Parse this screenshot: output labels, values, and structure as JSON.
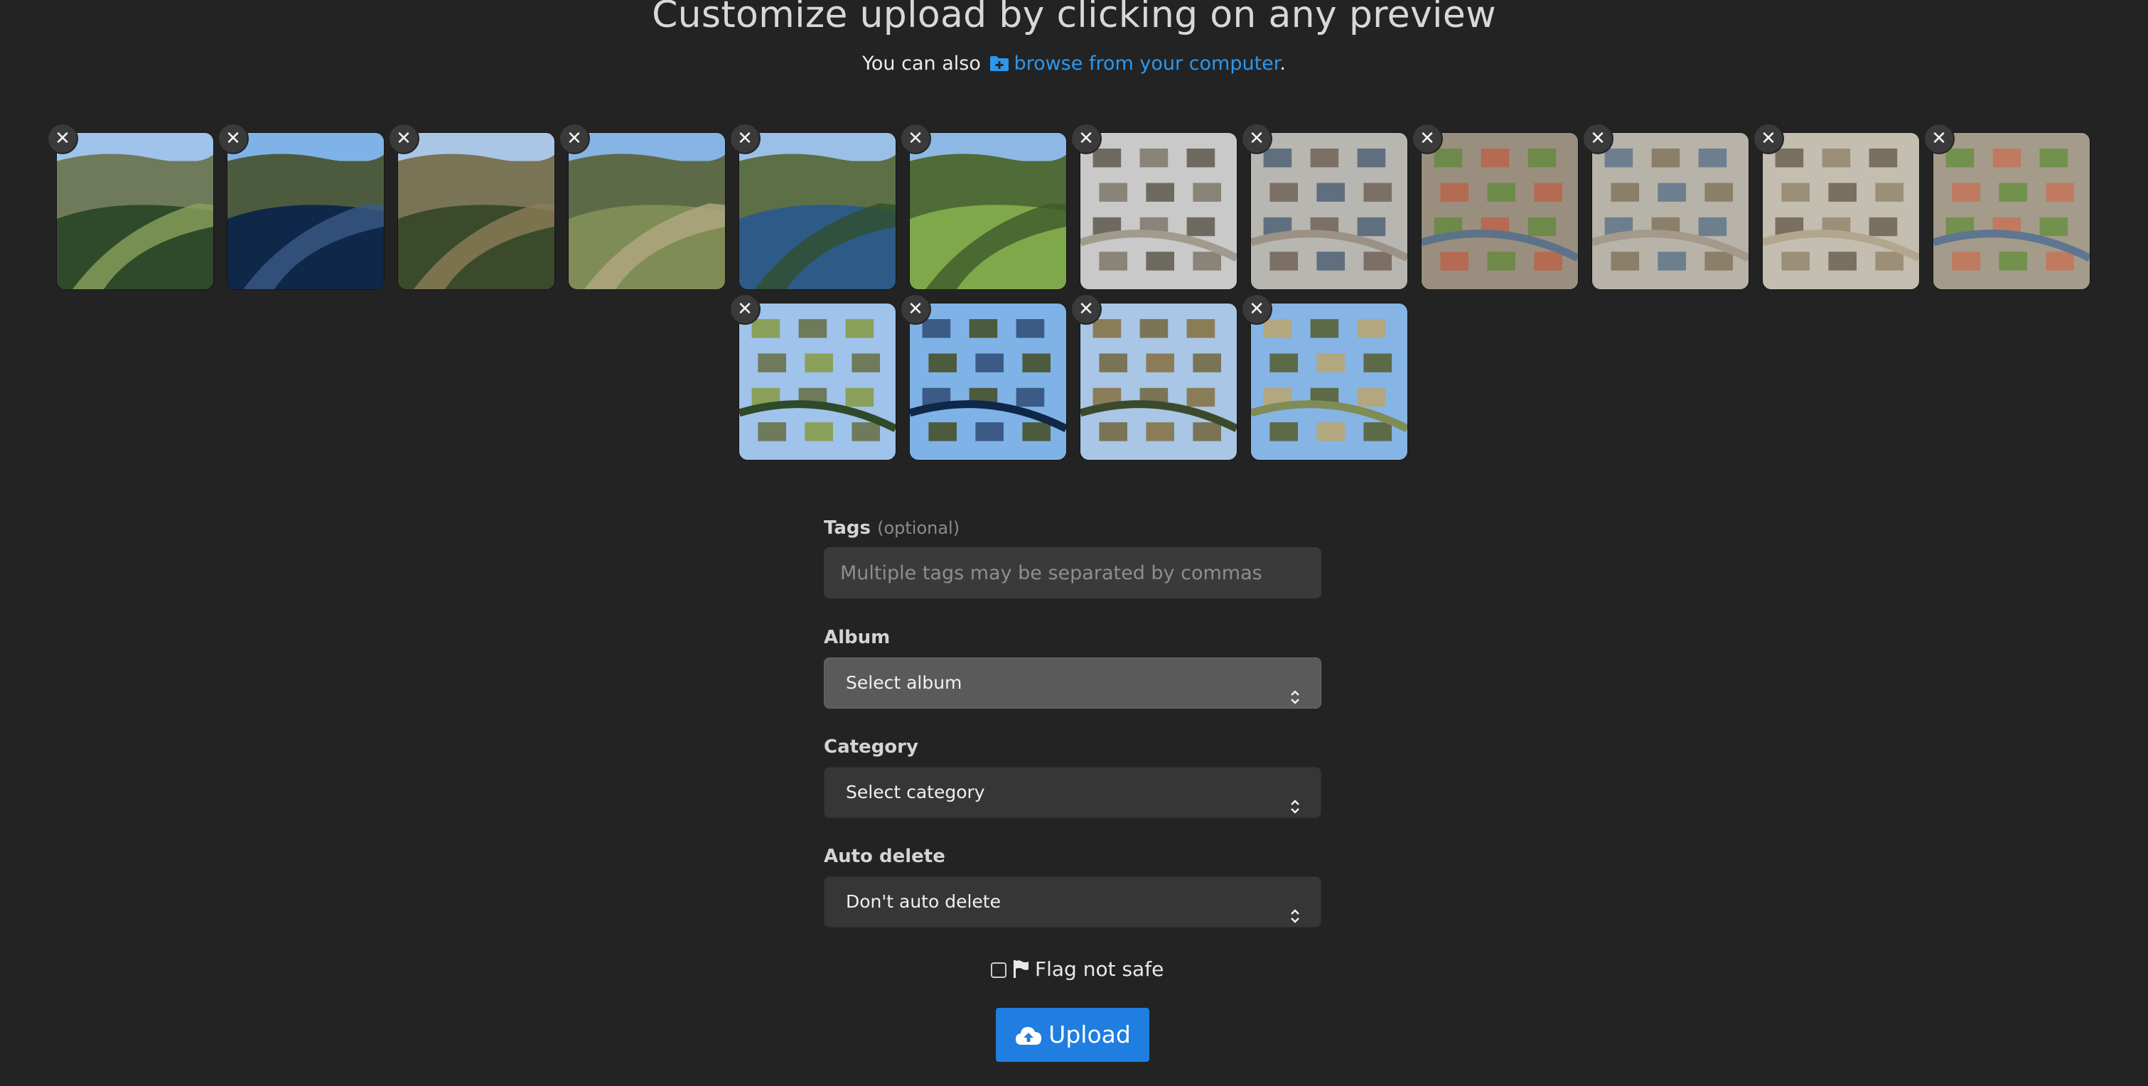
{
  "header": {
    "title": "Customize upload by clicking on any preview",
    "browse_prefix": "You can also",
    "browse_link": "browse from your computer",
    "browse_suffix": "."
  },
  "icons": {
    "remove": "close-icon",
    "browse": "folder-plus-icon",
    "nsfw": "flag-icon",
    "upload": "cloud-upload-icon",
    "select": "chevron-up-down-icon"
  },
  "previews": [
    {
      "name": "green-valley-hillside",
      "remove_glyph": "✕"
    },
    {
      "name": "blue-reservoir",
      "remove_glyph": "✕"
    },
    {
      "name": "moorland-trees",
      "remove_glyph": "✕"
    },
    {
      "name": "valley-track",
      "remove_glyph": "✕"
    },
    {
      "name": "reservoir-forest",
      "remove_glyph": "✕"
    },
    {
      "name": "green-slope",
      "remove_glyph": "✕"
    },
    {
      "name": "hazy-construction-site",
      "remove_glyph": "✕"
    },
    {
      "name": "housing-estate-aerial",
      "remove_glyph": "✕"
    },
    {
      "name": "houses-rows",
      "remove_glyph": "✕"
    },
    {
      "name": "estate-building-plots",
      "remove_glyph": "✕"
    },
    {
      "name": "cleared-site-roads",
      "remove_glyph": "✕"
    },
    {
      "name": "houses-top-down",
      "remove_glyph": "✕"
    },
    {
      "name": "estate-street-plots",
      "remove_glyph": "✕"
    },
    {
      "name": "construction-roadway",
      "remove_glyph": "✕"
    },
    {
      "name": "estate-overview",
      "remove_glyph": "✕"
    },
    {
      "name": "estate-gardens",
      "remove_glyph": "✕"
    }
  ],
  "form": {
    "tags_label": "Tags",
    "tags_optional": "(optional)",
    "tags_placeholder": "Multiple tags may be separated by commas",
    "tags_value": "",
    "album_label": "Album",
    "album_value": "Select album",
    "category_label": "Category",
    "category_value": "Select category",
    "autodelete_label": "Auto delete",
    "autodelete_value": "Don't auto delete",
    "nsfw_label": "Flag not safe",
    "nsfw_checked": false,
    "upload_label": "Upload"
  },
  "colors": {
    "background": "#232323",
    "accent": "#1f7ee0",
    "link": "#2b98f0"
  }
}
